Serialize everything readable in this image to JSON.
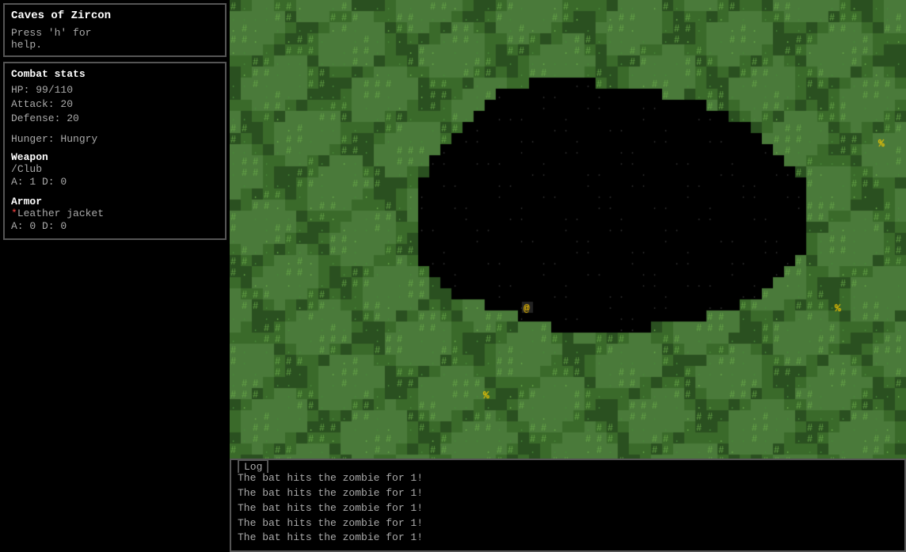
{
  "sidebar": {
    "title": "Caves of Zircon",
    "help_text": "Press 'h' for\nhelp.",
    "stats_title": "Combat stats",
    "hp_label": "HP:",
    "hp_current": "99",
    "hp_max": "110",
    "attack_label": "Attack:",
    "attack_value": "20",
    "defense_label": "Defense:",
    "defense_value": "20",
    "hunger_label": "Hunger:",
    "hunger_value": "Hungry",
    "weapon_title": "Weapon",
    "weapon_icon": "/",
    "weapon_name": "Club",
    "weapon_stats": "A: 1 D: 0",
    "armor_title": "Armor",
    "armor_icon": "*",
    "armor_name": "Leather jacket",
    "armor_stats": "A: 0 D: 0"
  },
  "log": {
    "tab_label": "Log",
    "messages": [
      "The bat hits the zombie for 1!",
      "The bat hits the zombie for 1!",
      "The bat hits the zombie for 1!",
      "The bat hits the zombie for 1!",
      "The bat hits the zombie for 1!"
    ]
  },
  "colors": {
    "bg": "#000000",
    "border": "#555555",
    "text_normal": "#aaaaaa",
    "text_bright": "#ffffff",
    "green_tile": "#4a7a3a",
    "green_dark": "#2a5a2a",
    "player_color": "#ffcc00",
    "enemy_color": "#ffcc00",
    "floor_color": "#555555",
    "cave_wall": "#6a8a4a"
  }
}
